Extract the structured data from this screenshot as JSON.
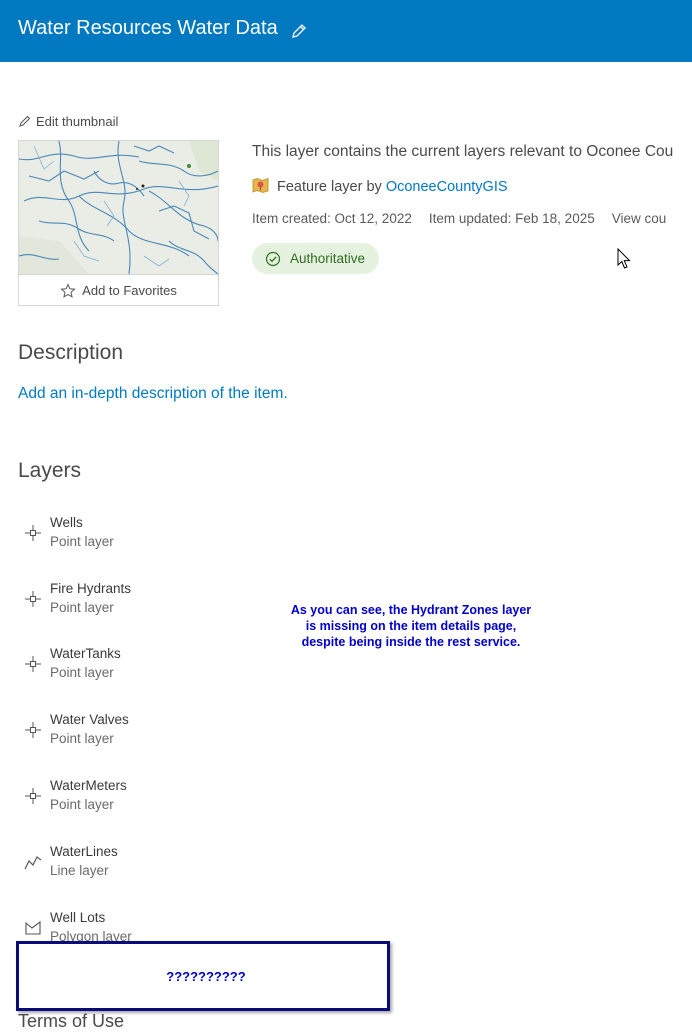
{
  "header": {
    "title": "Water Resources Water Data",
    "edit_icon": "pencil-icon",
    "background": "#0079c1"
  },
  "thumbnail": {
    "edit_label": "Edit thumbnail",
    "favorites_label": "Add to Favorites"
  },
  "item": {
    "summary": "This layer contains the current layers relevant to Oconee Cou",
    "type_prefix": "Feature layer by ",
    "owner": "OconeeCountyGIS",
    "created": "Item created: Oct 12, 2022",
    "updated": "Item updated: Feb 18, 2025",
    "view_count": "View cou",
    "badge": "Authoritative"
  },
  "description": {
    "heading": "Description",
    "link": "Add an in-depth description of the item."
  },
  "layers": {
    "heading": "Layers",
    "items": [
      {
        "name": "Wells",
        "type": "Point layer",
        "icon": "point-layer-icon"
      },
      {
        "name": "Fire Hydrants",
        "type": "Point layer",
        "icon": "point-layer-icon"
      },
      {
        "name": "WaterTanks",
        "type": "Point layer",
        "icon": "point-layer-icon"
      },
      {
        "name": "Water Valves",
        "type": "Point layer",
        "icon": "point-layer-icon"
      },
      {
        "name": "WaterMeters",
        "type": "Point layer",
        "icon": "point-layer-icon"
      },
      {
        "name": "WaterLines",
        "type": "Line layer",
        "icon": "line-layer-icon"
      },
      {
        "name": "Well Lots",
        "type": "Polygon layer",
        "icon": "polygon-layer-icon"
      }
    ]
  },
  "annotation": {
    "text": "As you can see, the Hydrant Zones layer is missing on the item details page, despite being inside the rest service.",
    "box_text": "??????????",
    "color": "#0000cc"
  },
  "footer_cut_text": "Terms of Use"
}
